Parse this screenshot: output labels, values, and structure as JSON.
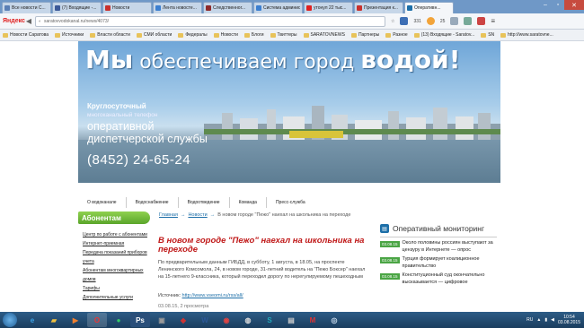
{
  "browser": {
    "tabs": [
      {
        "label": "Все новости С...",
        "color": "#5a7fb5",
        "active": false
      },
      {
        "label": "(7) Входящие -...",
        "color": "#3b5998",
        "active": false
      },
      {
        "label": "Новости",
        "color": "#c9302c",
        "active": false
      },
      {
        "label": "Лента новосте...",
        "color": "#3c7fd0",
        "active": false
      },
      {
        "label": "Следственног...",
        "color": "#8e2a2a",
        "active": false
      },
      {
        "label": "Система админист...",
        "color": "#3c7fd0",
        "active": false
      },
      {
        "label": "утонул 22 тыс...",
        "color": "#e02020",
        "active": false
      },
      {
        "label": "Презентация к...",
        "color": "#c9302c",
        "active": false
      },
      {
        "label": "Оперативн...",
        "color": "#1d6fa8",
        "active": true
      }
    ],
    "yandex_logo": "Яндекс",
    "url": "saratovvodokanal.ru/news/4073/",
    "ext_mail_count": "331",
    "ext_weather": "25",
    "bookmarks": [
      "Новости Саратова",
      "Источники",
      "Власти области",
      "СМИ области",
      "Федералы",
      "Новости",
      "Блоги",
      "Твиттеры",
      "SARATOVNEWS",
      "Партнеры",
      "Разное",
      "(13) Входящие - Saratov...",
      "SN",
      "http://www.saratovne..."
    ]
  },
  "banner": {
    "headline_part1": "Мы",
    "headline_part2": "обеспечиваем город",
    "headline_part3": "водой!",
    "sub1": "Круглосуточный",
    "sub2": "многоканальный телефон",
    "sub3_line1": "оперативной",
    "sub3_line2": "диспетчерской службы",
    "phone": "(8452)  24-65-24"
  },
  "menu": [
    "О водоканале",
    "Водоснабжение",
    "Водоотведение",
    "Команда",
    "Пресс-служба"
  ],
  "sidebar": {
    "header": "Абонентам",
    "items": [
      "Центр по работе с абонентами",
      "Интернет-приемная",
      "Передача показаний приборов",
      "учета",
      "Абонентам многоквартирных",
      "домов",
      "Тарифы",
      "Дополнительные услуги"
    ]
  },
  "breadcrumb": {
    "home": "Главная",
    "news": "Новости",
    "current": "В новом городе \"Пежо\" наехал на школьника на переходе"
  },
  "article": {
    "title": "В новом городе \"Пежо\" наехал на школьника на переходе",
    "body": "По предварительным данным ГИБДД, в субботу, 1 августа, в 18.05, на проспекте Ленинского Комсомола, 24, в новом городе, 31-летний водитель на \"Пежо Боксер\" наехал на 15-летнего 9-классника, который переходил дорогу по нерегулируемому пешеходным",
    "source_label": "Источник:",
    "source_url": "http://www.vseomi.ru/rss/all/",
    "meta": "03.08.15, 2 просмотра"
  },
  "monitoring": {
    "title": "Оперативный мониторинг",
    "items": [
      {
        "time": "03.08.15",
        "text": "Около половины россиян выступают за цензуру в Интернете — опрос"
      },
      {
        "time": "03.08.15",
        "text": "Турция формирует коалиционное правительство"
      },
      {
        "time": "03.08.15",
        "text": "Конституционный суд окончательно высказывается — цифровое"
      }
    ]
  },
  "taskbar": {
    "lang": "RU",
    "time": "10:54",
    "date": "03.08.2015"
  }
}
